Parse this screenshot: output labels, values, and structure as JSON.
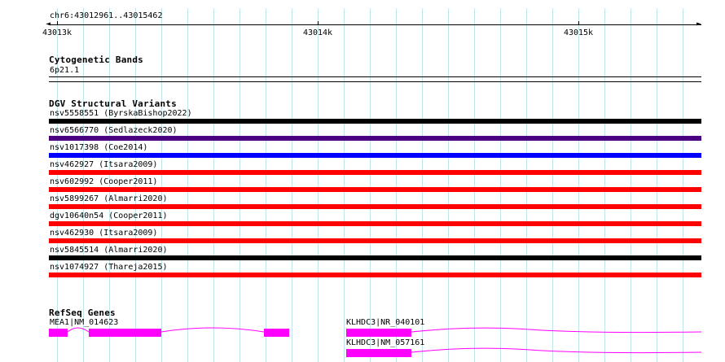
{
  "region": "chr6:43012961..43015462",
  "ruler": {
    "ticks": [
      "43013k",
      "43014k",
      "43015k"
    ]
  },
  "tracks": {
    "cytogenetic": {
      "title": "Cytogenetic Bands",
      "band": "6p21.1"
    },
    "dgv": {
      "title": "DGV Structural Variants",
      "variants": [
        {
          "label": "nsv5558551 (ByrskaBishop2022)",
          "color": "#000000"
        },
        {
          "label": "nsv6566770 (Sedlazeck2020)",
          "color": "#4b0082"
        },
        {
          "label": "nsv1017398 (Coe2014)",
          "color": "#0000ff"
        },
        {
          "label": "nsv462927 (Itsara2009)",
          "color": "#ff0000"
        },
        {
          "label": "nsv602992 (Cooper2011)",
          "color": "#ff0000"
        },
        {
          "label": "nsv5899267 (Almarri2020)",
          "color": "#ff0000"
        },
        {
          "label": "dgv10640n54 (Cooper2011)",
          "color": "#ff0000"
        },
        {
          "label": "nsv462930 (Itsara2009)",
          "color": "#ff0000"
        },
        {
          "label": "nsv5845514 (Almarri2020)",
          "color": "#000000"
        },
        {
          "label": "nsv1074927 (Thareja2015)",
          "color": "#ff0000"
        }
      ]
    },
    "refseq": {
      "title": "RefSeq Genes",
      "genes": [
        {
          "label": "MEA1|NM_014623"
        },
        {
          "label": "KLHDC3|NR_040101"
        },
        {
          "label": "KLHDC3|NM_057161"
        }
      ],
      "color": "#ff00ff"
    }
  }
}
